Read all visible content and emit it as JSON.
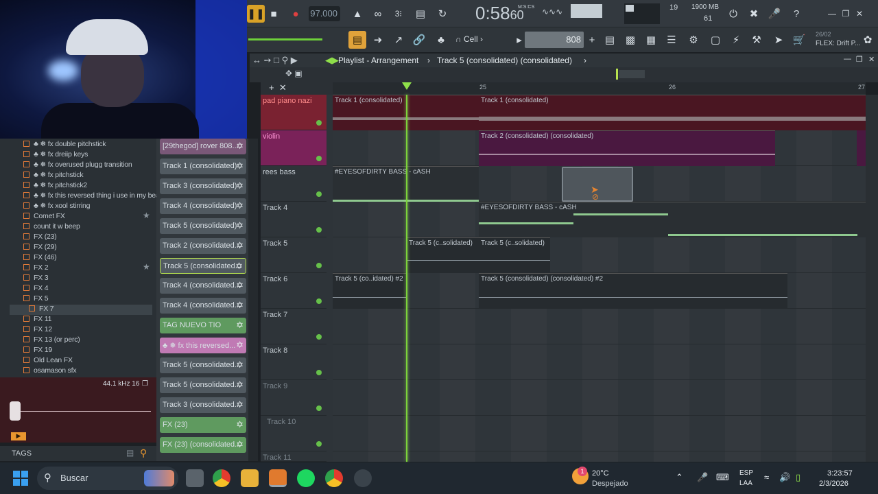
{
  "top": {
    "tempo": "97.000",
    "time": "0:58",
    "time_sub": "60",
    "time_label": "M:S:CS",
    "cpu_num": "19",
    "memory": "1900 MB",
    "poly": "61",
    "pattern_value": "808",
    "snap_label": "Cell",
    "hint_date": "26/02",
    "hint_text": "FLEX: Drift P..."
  },
  "browser": {
    "items": [
      {
        "label": "♣ ❅ fx double pitchstick"
      },
      {
        "label": "♣ ❅ fx dreiip keys"
      },
      {
        "label": "♣ ❅ fx overused plugg transition"
      },
      {
        "label": "♣ ❅ fx pitchstick"
      },
      {
        "label": "♣ ❅ fx pitchstick2"
      },
      {
        "label": "♣ ❅ fx this reversed thing i use in my beats"
      },
      {
        "label": "♣ ❅ fx xool stirring"
      },
      {
        "label": "Comet FX"
      },
      {
        "label": "count it w beep"
      },
      {
        "label": "FX (23)"
      },
      {
        "label": "FX (29)"
      },
      {
        "label": "FX (46)"
      },
      {
        "label": "FX 2"
      },
      {
        "label": "FX 3"
      },
      {
        "label": "FX 4"
      },
      {
        "label": "FX 5"
      },
      {
        "label": "FX 7"
      },
      {
        "label": "FX 11"
      },
      {
        "label": "FX 12"
      },
      {
        "label": "FX 13 (or perc)"
      },
      {
        "label": "FX 19"
      },
      {
        "label": "Old Lean FX"
      },
      {
        "label": "osamason sfx"
      }
    ],
    "sample_info": "44.1 kHz 16",
    "tags_label": "TAGS"
  },
  "picker": {
    "items": [
      {
        "label": "[29thegod] rover 808..."
      },
      {
        "label": "Track 1 (consolidated)"
      },
      {
        "label": "Track 3 (consolidated)"
      },
      {
        "label": "Track 4 (consolidated)"
      },
      {
        "label": "Track 5 (consolidated)"
      },
      {
        "label": "Track 2 (consolidated..."
      },
      {
        "label": "Track 5 (consolidated..."
      },
      {
        "label": "Track 4 (consolidated..."
      },
      {
        "label": "Track 4 (consolidated..."
      },
      {
        "label": "TAG NUEVO TIO"
      },
      {
        "label": "♣ ❅ fx this reversed..."
      },
      {
        "label": "Track 5 (consolidated..."
      },
      {
        "label": "Track 5 (consolidated..."
      },
      {
        "label": "Track 3 (consolidated..."
      },
      {
        "label": "FX (23)"
      },
      {
        "label": "FX (23) (consolidated..."
      }
    ]
  },
  "playlist": {
    "title": "Playlist - Arrangement",
    "current_pattern": "Track 5 (consolidated) (consolidated)",
    "ruler": {
      "m25": "25",
      "m26": "26",
      "m27": "27"
    },
    "tracks": [
      {
        "name": "pad piano nazi"
      },
      {
        "name": "violin"
      },
      {
        "name": "rees bass"
      },
      {
        "name": "Track 4"
      },
      {
        "name": "Track 5"
      },
      {
        "name": "Track 6"
      },
      {
        "name": "Track 7"
      },
      {
        "name": "Track 8"
      },
      {
        "name": "Track 9"
      },
      {
        "name": "Track 10"
      },
      {
        "name": "Track 11"
      }
    ],
    "clips": {
      "t1a": "Track 1 (consolidated)",
      "t1b": "Track 1 (consolidated)",
      "t2": "Track 2 (consolidated) (consolidated)",
      "t3": "#EYESOFDIRTY BASS - cASH",
      "t4": "#EYESOFDIRTY BASS - cASH",
      "t5a": "Track 5 (c..solidated)",
      "t5b": "Track 5 (c..solidated)",
      "t6a": "Track 5 (co..idated) #2",
      "t6b": "Track 5 (consolidated) (consolidated) #2"
    }
  },
  "taskbar": {
    "search_placeholder": "Buscar",
    "weather_temp": "20°C",
    "weather_text": "Despejado",
    "lang1": "ESP",
    "lang2": "LAA",
    "clock_time": "3:23:57",
    "clock_date": "2/3/2026",
    "notif_badge": "1"
  }
}
